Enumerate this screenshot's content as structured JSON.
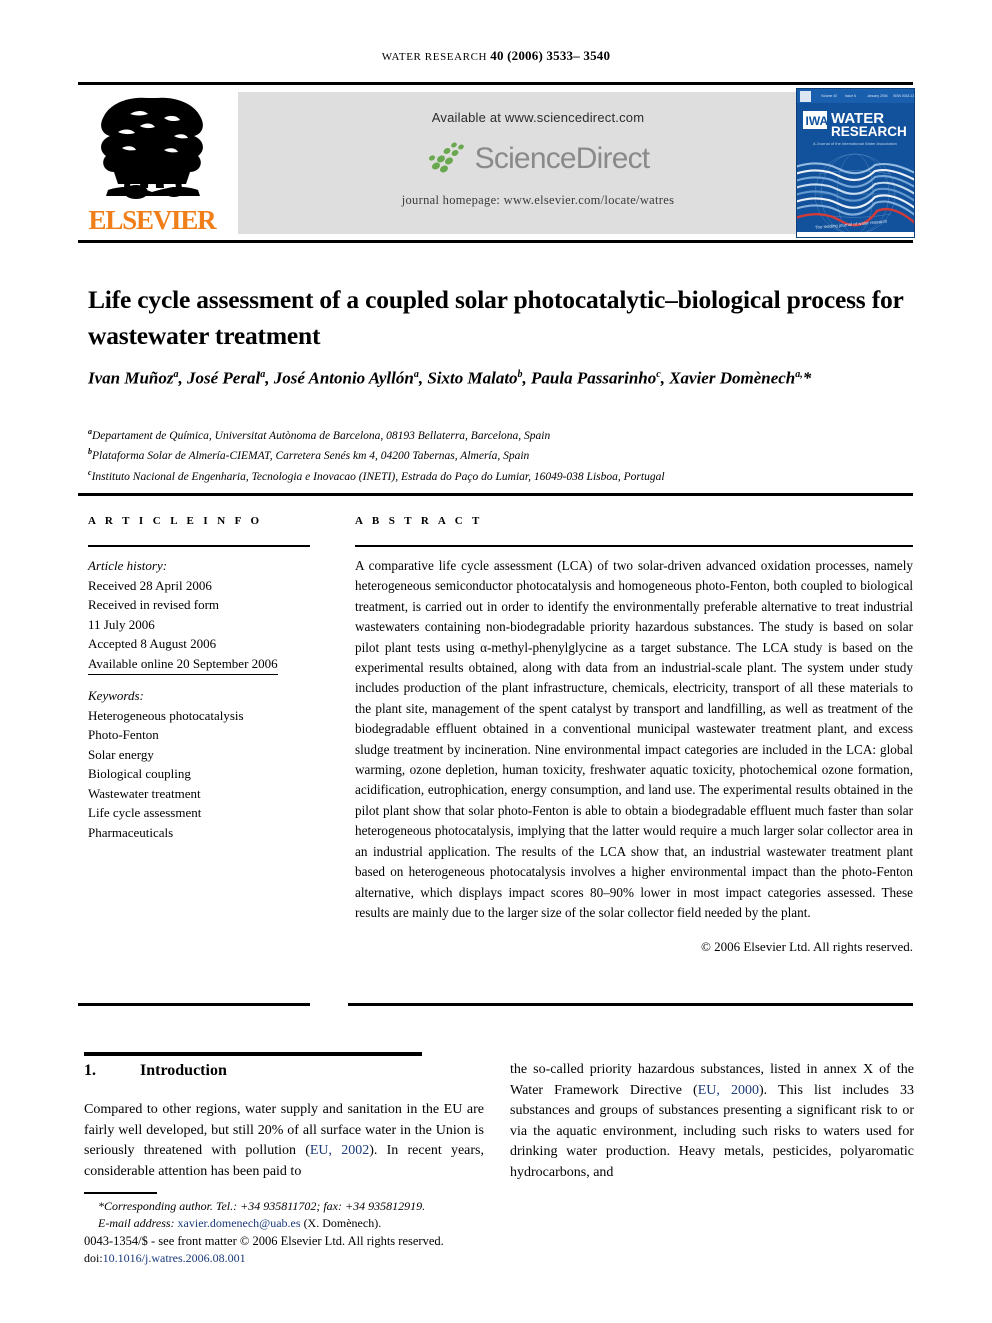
{
  "running_head": {
    "journal_name": "WATER RESEARCH",
    "volume_year_pages": "40 (2006) 3533– 3540"
  },
  "masthead": {
    "elsevier_wordmark": "ELSEVIER",
    "available_at": "Available at www.sciencedirect.com",
    "sciencedirect_wordmark": "ScienceDirect",
    "journal_homepage": "journal homepage: www.elsevier.com/locate/watres",
    "cover": {
      "iwa_mark": "IWA",
      "title_line1": "WATER",
      "title_line2": "RESEARCH",
      "subtitle": "A Journal of the International Water Association",
      "banner_items": [
        "Volume 40",
        "Issue 6",
        "January 2006",
        "ISSN 0043-1354"
      ],
      "curve_caption": "The leading journal of water research"
    }
  },
  "article": {
    "title": "Life cycle assessment of a coupled solar photocatalytic–biological process for wastewater treatment",
    "authors_html": "Ivan Muñoz<sup>a</sup>, José Peral<sup>a</sup>, José Antonio Ayllón<sup>a</sup>, Sixto Malato<sup>b</sup>, Paula Passarinho<sup>c</sup>, Xavier Domènech<sup>a,</sup>*",
    "affiliations": [
      {
        "marker": "a",
        "text": "Departament de Química, Universitat Autònoma de Barcelona, 08193 Bellaterra, Barcelona, Spain"
      },
      {
        "marker": "b",
        "text": "Plataforma Solar de Almería-CIEMAT, Carretera Senés km 4, 04200 Tabernas, Almería, Spain"
      },
      {
        "marker": "c",
        "text": "Instituto Nacional de Engenharia, Tecnologia e Inovacao (INETI), Estrada do Paço do Lumiar, 16049-038 Lisboa, Portugal"
      }
    ]
  },
  "article_info": {
    "heading": "A R T I C L E   I N F O",
    "history_label": "Article history:",
    "history": [
      "Received 28 April 2006",
      "Received in revised form",
      "11 July 2006",
      "Accepted 8 August 2006"
    ],
    "available_online": "Available online 20 September 2006",
    "keywords_label": "Keywords:",
    "keywords": [
      "Heterogeneous photocatalysis",
      "Photo-Fenton",
      "Solar energy",
      "Biological coupling",
      "Wastewater treatment",
      "Life cycle assessment",
      "Pharmaceuticals"
    ]
  },
  "abstract": {
    "heading": "A B S T R A C T",
    "text": "A comparative life cycle assessment (LCA) of two solar-driven advanced oxidation processes, namely heterogeneous semiconductor photocatalysis and homogeneous photo-Fenton, both coupled to biological treatment, is carried out in order to identify the environmentally preferable alternative to treat industrial wastewaters containing non-biodegradable priority hazardous substances. The study is based on solar pilot plant tests using α-methyl-phenylglycine as a target substance. The LCA study is based on the experimental results obtained, along with data from an industrial-scale plant. The system under study includes production of the plant infrastructure, chemicals, electricity, transport of all these materials to the plant site, management of the spent catalyst by transport and landfilling, as well as treatment of the biodegradable effluent obtained in a conventional municipal wastewater treatment plant, and excess sludge treatment by incineration. Nine environmental impact categories are included in the LCA: global warming, ozone depletion, human toxicity, freshwater aquatic toxicity, photochemical ozone formation, acidification, eutrophication, energy consumption, and land use. The experimental results obtained in the pilot plant show that solar photo-Fenton is able to obtain a biodegradable effluent much faster than solar heterogeneous photocatalysis, implying that the latter would require a much larger solar collector area in an industrial application. The results of the LCA show that, an industrial wastewater treatment plant based on heterogeneous photocatalysis involves a higher environmental impact than the photo-Fenton alternative, which displays impact scores 80–90% lower in most impact categories assessed. These results are mainly due to the larger size of the solar collector field needed by the plant.",
    "copyright": "© 2006 Elsevier Ltd. All rights reserved."
  },
  "introduction": {
    "number": "1.",
    "title": "Introduction",
    "left_paragraph_pre": "Compared to other regions, water supply and sanitation in the EU are fairly well developed, but still 20% of all surface water in the Union is seriously threatened with pollution (",
    "left_citation": "EU, 2002",
    "left_paragraph_post": "). In recent years, considerable attention has been paid to",
    "right_paragraph_pre": "the so-called priority hazardous substances, listed in annex X of the Water Framework Directive (",
    "right_citation": "EU, 2000",
    "right_paragraph_post": "). This list includes 33 substances and groups of substances presenting a significant risk to or via the aquatic environment, including such risks to waters used for drinking water production. Heavy metals, pesticides, polyaromatic hydrocarbons, and"
  },
  "footnotes": {
    "corresponding": "Corresponding author. Tel.: +34 935811702; fax: +34 935812919.",
    "email_label": "E-mail address:",
    "email": "xavier.domenech@uab.es",
    "email_owner": "(X. Domènech).",
    "issn_line": "0043-1354/$ - see front matter © 2006 Elsevier Ltd. All rights reserved.",
    "doi_label": "doi:",
    "doi": "10.1016/j.watres.2006.08.001"
  },
  "colors": {
    "elsevier_orange": "#F07F19",
    "sciencedirect_gray": "#8a8a8a",
    "sciencedirect_green": "#6aa84f",
    "band_gray": "#dedede",
    "cover_blue": "#12519b",
    "link_blue": "#1a3a7a"
  }
}
